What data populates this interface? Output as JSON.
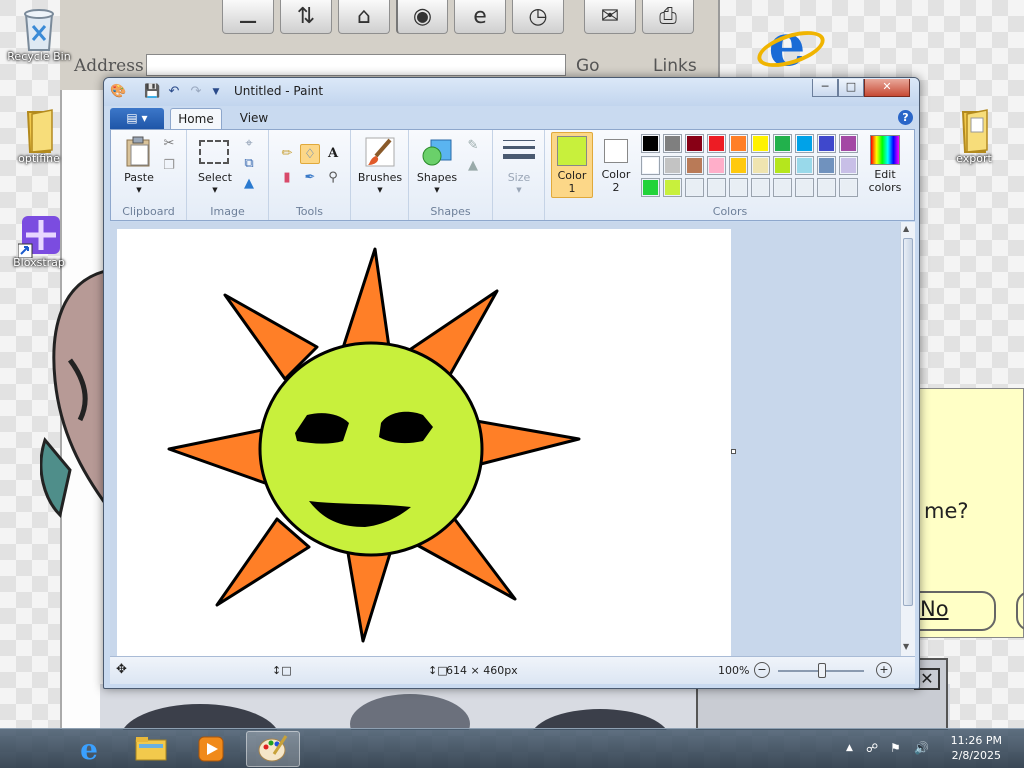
{
  "desktop": {
    "icons": [
      {
        "label": "Recycle Bin",
        "icon": "recycle-bin-icon"
      },
      {
        "label": "optifine",
        "icon": "folder-icon"
      },
      {
        "label": "Bloxstrap",
        "icon": "bloxstrap-icon"
      },
      {
        "label": "export",
        "icon": "folder-icon"
      }
    ]
  },
  "background_browser": {
    "address_label": "Address",
    "go_label": "Go",
    "links_label": "Links"
  },
  "background_dialog": {
    "question": "me?",
    "no_label": "No"
  },
  "paint": {
    "title": "Untitled - Paint",
    "tabs": {
      "home": "Home",
      "view": "View"
    },
    "groups": {
      "clipboard": {
        "label": "Clipboard",
        "paste": "Paste"
      },
      "image": {
        "label": "Image",
        "select": "Select"
      },
      "tools": {
        "label": "Tools"
      },
      "brushes": {
        "label": "Brushes"
      },
      "shapes": {
        "label": "Shapes",
        "shapes_btn": "Shapes",
        "size": "Size"
      },
      "colors": {
        "label": "Colors",
        "color1": "Color\n1",
        "color1_a": "Color",
        "color1_b": "1",
        "color2_a": "Color",
        "color2_b": "2",
        "edit_a": "Edit",
        "edit_b": "colors",
        "color1_value": "#c8f03c",
        "color2_value": "#ffffff",
        "palette": [
          "#000000",
          "#7f7f7f",
          "#880015",
          "#ed1c24",
          "#ff7f27",
          "#fff200",
          "#22b14c",
          "#00a2e8",
          "#3f48cc",
          "#a349a4",
          "#ffffff",
          "#c3c3c3",
          "#b97a57",
          "#ffaec9",
          "#ffc90e",
          "#efe4b0",
          "#b5e61d",
          "#99d9ea",
          "#7092be",
          "#c8bfe7",
          "#22d33a",
          "#c8f03c",
          "#e8eef4",
          "#e8eef4",
          "#e8eef4",
          "#e8eef4",
          "#e8eef4",
          "#e8eef4",
          "#e8eef4",
          "#e8eef4"
        ]
      }
    },
    "status": {
      "dimensions": "614 × 460px",
      "zoom": "100%"
    },
    "drawing": {
      "sun_fill": "#c8f03c",
      "ray_fill": "#ff7f27"
    }
  },
  "taskbar": {
    "time": "11:26 PM",
    "date": "2/8/2025"
  }
}
